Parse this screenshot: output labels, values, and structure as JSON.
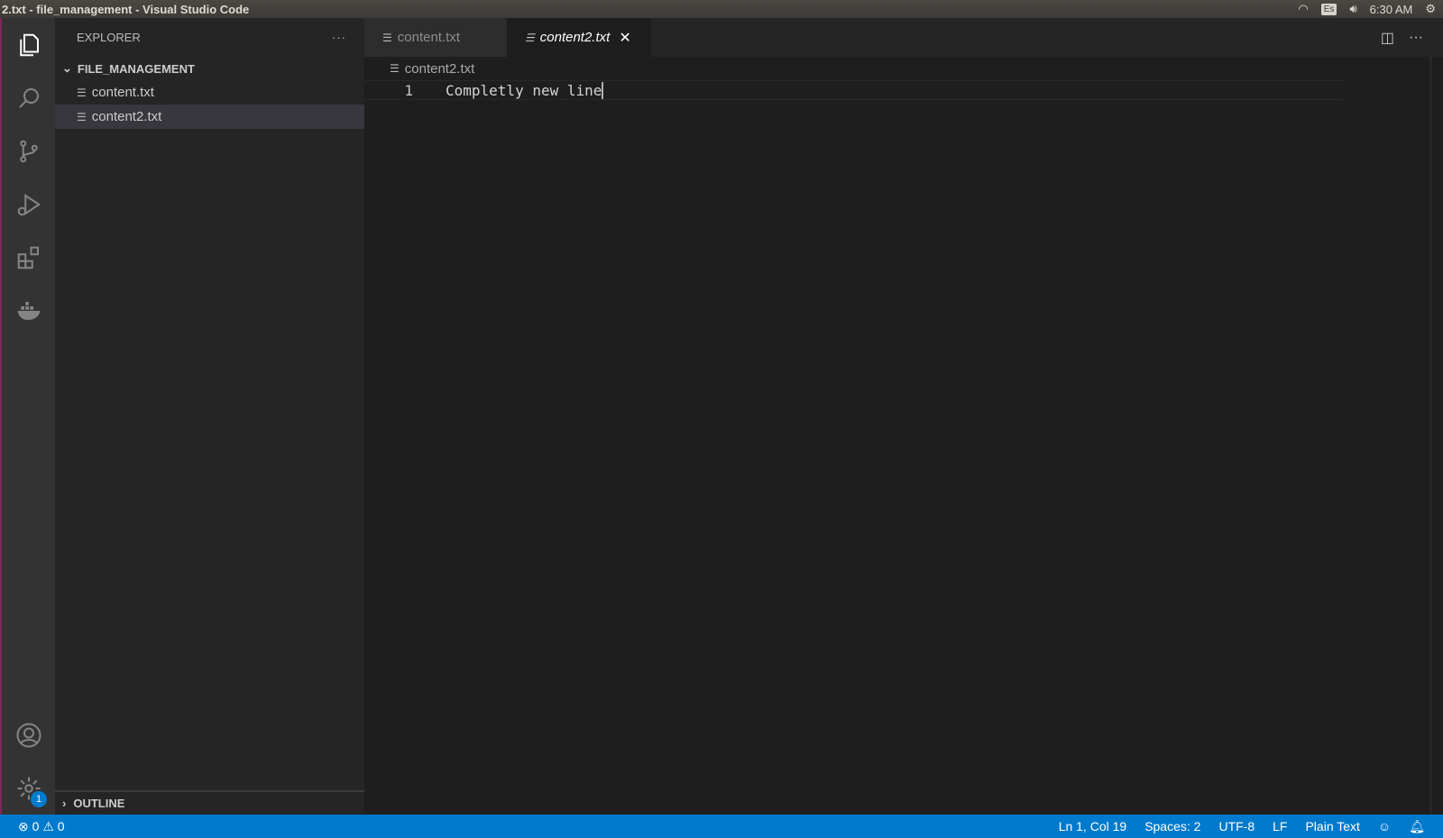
{
  "window": {
    "title": "2.txt - file_management - Visual Studio Code"
  },
  "system": {
    "keyboard": "Es",
    "time": "6:30 AM"
  },
  "activity": {
    "settings_badge": "1"
  },
  "sidebar": {
    "title": "EXPLORER",
    "more": "···",
    "folder": "FILE_MANAGEMENT",
    "files": [
      "content.txt",
      "content2.txt"
    ],
    "outline": "OUTLINE"
  },
  "tabs": [
    {
      "label": "content.txt"
    },
    {
      "label": "content2.txt"
    }
  ],
  "editor": {
    "breadcrumb": "content2.txt",
    "line_number": "1",
    "line_text": "Completly new line"
  },
  "status": {
    "errors": "0",
    "warnings": "0",
    "position": "Ln 1, Col 19",
    "spaces": "Spaces: 2",
    "encoding": "UTF-8",
    "eol": "LF",
    "language": "Plain Text"
  }
}
